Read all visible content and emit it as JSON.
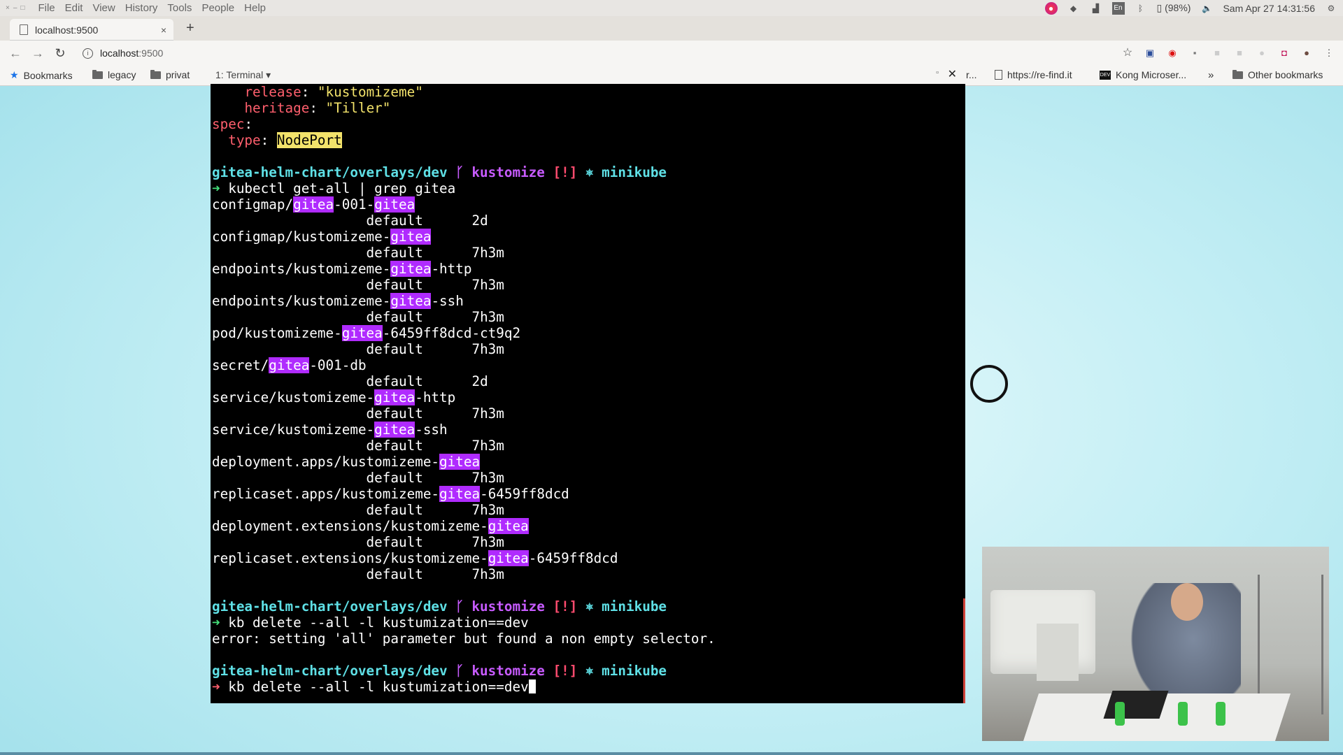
{
  "os_menubar": {
    "window_buttons": [
      "×",
      "–",
      "□"
    ],
    "menus": [
      "File",
      "Edit",
      "View",
      "History",
      "Tools",
      "People",
      "Help"
    ],
    "battery": "(98%)",
    "keyboard_layout": "En",
    "datetime": "Sam Apr 27 14:31:56",
    "tray_icons": [
      "firefox-icon",
      "dropbox-icon",
      "signal-icon",
      "keyboard-icon",
      "bluetooth-icon",
      "battery-icon",
      "volume-icon",
      "user-icon"
    ]
  },
  "browser": {
    "tab": {
      "title": "localhost:9500",
      "close": "×"
    },
    "new_tab": "+",
    "address": {
      "host": "localhost",
      "port": ":9500"
    },
    "bookmarks": {
      "items": [
        {
          "label": "Bookmarks",
          "icon": "star-icon"
        },
        {
          "label": "legacy",
          "icon": "folder-icon"
        },
        {
          "label": "privat",
          "icon": "folder-icon"
        },
        {
          "label": "r...",
          "icon": ""
        },
        {
          "label": "https://re-find.it",
          "icon": "page-icon"
        },
        {
          "label": "Kong Microser...",
          "icon": "dev-icon"
        }
      ],
      "overflow": "»",
      "other": "Other bookmarks"
    }
  },
  "terminal": {
    "title": "1: Terminal",
    "lines": [
      [
        {
          "t": "    "
        },
        {
          "t": "release",
          "c": "r"
        },
        {
          "t": ": "
        },
        {
          "t": "\"kustomizeme\"",
          "c": "y"
        }
      ],
      [
        {
          "t": "    "
        },
        {
          "t": "heritage",
          "c": "r"
        },
        {
          "t": ": "
        },
        {
          "t": "\"Tiller\"",
          "c": "y"
        }
      ],
      [
        {
          "t": "spec",
          "c": "r"
        },
        {
          "t": ":"
        }
      ],
      [
        {
          "t": "  "
        },
        {
          "t": "type",
          "c": "r"
        },
        {
          "t": ": "
        },
        {
          "t": "NodePort",
          "c": "yb"
        }
      ],
      [
        {
          "t": ""
        }
      ],
      [
        {
          "t": "gitea-helm-chart/overlays/dev ",
          "c": "cy"
        },
        {
          "t": "ᚴ kustomize",
          "c": "pk"
        },
        {
          "t": " [!]",
          "c": "rd"
        },
        {
          "t": " ⎈ minikube",
          "c": "cy"
        }
      ],
      [
        {
          "t": "➜ ",
          "c": "gr"
        },
        {
          "t": "kubectl get-all | grep gitea"
        }
      ],
      [
        {
          "t": "configmap/"
        },
        {
          "t": "gitea",
          "c": "hl"
        },
        {
          "t": "-001-"
        },
        {
          "t": "gitea",
          "c": "hl"
        }
      ],
      [
        {
          "t": "                   default      2d"
        }
      ],
      [
        {
          "t": "configmap/kustomizeme-"
        },
        {
          "t": "gitea",
          "c": "hl"
        }
      ],
      [
        {
          "t": "                   default      7h3m"
        }
      ],
      [
        {
          "t": "endpoints/kustomizeme-"
        },
        {
          "t": "gitea",
          "c": "hl"
        },
        {
          "t": "-http"
        }
      ],
      [
        {
          "t": "                   default      7h3m"
        }
      ],
      [
        {
          "t": "endpoints/kustomizeme-"
        },
        {
          "t": "gitea",
          "c": "hl"
        },
        {
          "t": "-ssh"
        }
      ],
      [
        {
          "t": "                   default      7h3m"
        }
      ],
      [
        {
          "t": "pod/kustomizeme-"
        },
        {
          "t": "gitea",
          "c": "hl"
        },
        {
          "t": "-6459ff8dcd-ct9q2"
        }
      ],
      [
        {
          "t": "                   default      7h3m"
        }
      ],
      [
        {
          "t": "secret/"
        },
        {
          "t": "gitea",
          "c": "hl"
        },
        {
          "t": "-001-db"
        }
      ],
      [
        {
          "t": "                   default      2d"
        }
      ],
      [
        {
          "t": "service/kustomizeme-"
        },
        {
          "t": "gitea",
          "c": "hl"
        },
        {
          "t": "-http"
        }
      ],
      [
        {
          "t": "                   default      7h3m"
        }
      ],
      [
        {
          "t": "service/kustomizeme-"
        },
        {
          "t": "gitea",
          "c": "hl"
        },
        {
          "t": "-ssh"
        }
      ],
      [
        {
          "t": "                   default      7h3m"
        }
      ],
      [
        {
          "t": "deployment.apps/kustomizeme-"
        },
        {
          "t": "gitea",
          "c": "hl"
        }
      ],
      [
        {
          "t": "                   default      7h3m"
        }
      ],
      [
        {
          "t": "replicaset.apps/kustomizeme-"
        },
        {
          "t": "gitea",
          "c": "hl"
        },
        {
          "t": "-6459ff8dcd"
        }
      ],
      [
        {
          "t": "                   default      7h3m"
        }
      ],
      [
        {
          "t": "deployment.extensions/kustomizeme-"
        },
        {
          "t": "gitea",
          "c": "hl"
        }
      ],
      [
        {
          "t": "                   default      7h3m"
        }
      ],
      [
        {
          "t": "replicaset.extensions/kustomizeme-"
        },
        {
          "t": "gitea",
          "c": "hl"
        },
        {
          "t": "-6459ff8dcd"
        }
      ],
      [
        {
          "t": "                   default      7h3m"
        }
      ],
      [
        {
          "t": ""
        }
      ],
      [
        {
          "t": "gitea-helm-chart/overlays/dev ",
          "c": "cy"
        },
        {
          "t": "ᚴ kustomize",
          "c": "pk"
        },
        {
          "t": " [!]",
          "c": "rd"
        },
        {
          "t": " ⎈ minikube",
          "c": "cy"
        }
      ],
      [
        {
          "t": "➜ ",
          "c": "gr"
        },
        {
          "t": "kb delete --all -l kustumization==dev"
        }
      ],
      [
        {
          "t": "error: setting 'all' parameter but found a non empty selector."
        }
      ],
      [
        {
          "t": ""
        }
      ],
      [
        {
          "t": "gitea-helm-chart/overlays/dev ",
          "c": "cy"
        },
        {
          "t": "ᚴ kustomize",
          "c": "pk"
        },
        {
          "t": " [!]",
          "c": "rd"
        },
        {
          "t": " ⎈ minikube",
          "c": "cy"
        }
      ],
      [
        {
          "t": "➜ ",
          "c": "r"
        },
        {
          "t": "kb delete --all -l kustumization==dev"
        },
        {
          "t": "",
          "c": "cursor"
        }
      ]
    ]
  }
}
